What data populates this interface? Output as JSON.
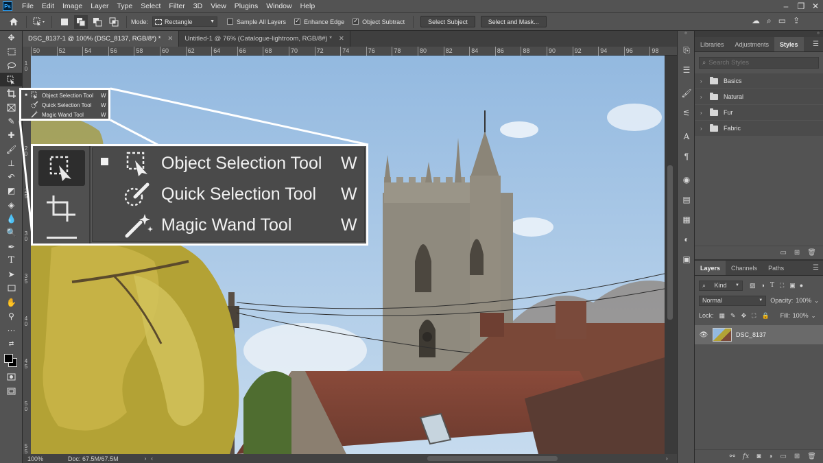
{
  "app": {
    "logo": "Ps"
  },
  "menu": {
    "items": [
      "File",
      "Edit",
      "Image",
      "Layer",
      "Type",
      "Select",
      "Filter",
      "3D",
      "View",
      "Plugins",
      "Window",
      "Help"
    ]
  },
  "options": {
    "mode_label": "Mode:",
    "mode_value": "Rectangle",
    "sample_all_layers": {
      "label": "Sample All Layers",
      "checked": false
    },
    "enhance_edge": {
      "label": "Enhance Edge",
      "checked": true
    },
    "object_subtract": {
      "label": "Object Subtract",
      "checked": true
    },
    "select_subject": "Select Subject",
    "select_and_mask": "Select and Mask..."
  },
  "doc_tabs": [
    {
      "title": "DSC_8137-1 @ 100% (DSC_8137, RGB/8*) *",
      "active": true
    },
    {
      "title": "Untitled-1 @ 76% (Catalogue-lightroom, RGB/8#) *",
      "active": false
    }
  ],
  "ruler": {
    "h_ticks": [
      "50",
      "52",
      "54",
      "56",
      "58",
      "60",
      "62",
      "64",
      "66",
      "68",
      "70",
      "72",
      "74",
      "76",
      "78",
      "80",
      "82",
      "84",
      "86",
      "88",
      "90",
      "92",
      "94",
      "96",
      "98"
    ],
    "v_ticks": [
      "1 0",
      "1 5",
      "2 0",
      "2 5",
      "3 0",
      "3 5",
      "4 0",
      "4 5",
      "5 0",
      "5 5"
    ]
  },
  "status": {
    "zoom": "100%",
    "doc": "Doc: 67.5M/67.5M"
  },
  "small_flyout": [
    {
      "label": "Object Selection Tool",
      "key": "W"
    },
    {
      "label": "Quick Selection Tool",
      "key": "W"
    },
    {
      "label": "Magic Wand Tool",
      "key": "W"
    }
  ],
  "big_flyout": [
    {
      "label": "Object Selection Tool",
      "key": "W"
    },
    {
      "label": "Quick Selection Tool",
      "key": "W"
    },
    {
      "label": "Magic Wand Tool",
      "key": "W"
    }
  ],
  "styles_panel": {
    "tabs": [
      "Libraries",
      "Adjustments",
      "Styles"
    ],
    "search_placeholder": "Search Styles",
    "folders": [
      "Basics",
      "Natural",
      "Fur",
      "Fabric"
    ]
  },
  "layers_panel": {
    "tabs": [
      "Layers",
      "Channels",
      "Paths"
    ],
    "kind": "Kind",
    "blend_mode": "Normal",
    "opacity_label": "Opacity:",
    "opacity_value": "100%",
    "lock_label": "Lock:",
    "fill_label": "Fill:",
    "fill_value": "100%",
    "layers": [
      {
        "name": "DSC_8137",
        "visible": true
      }
    ]
  }
}
